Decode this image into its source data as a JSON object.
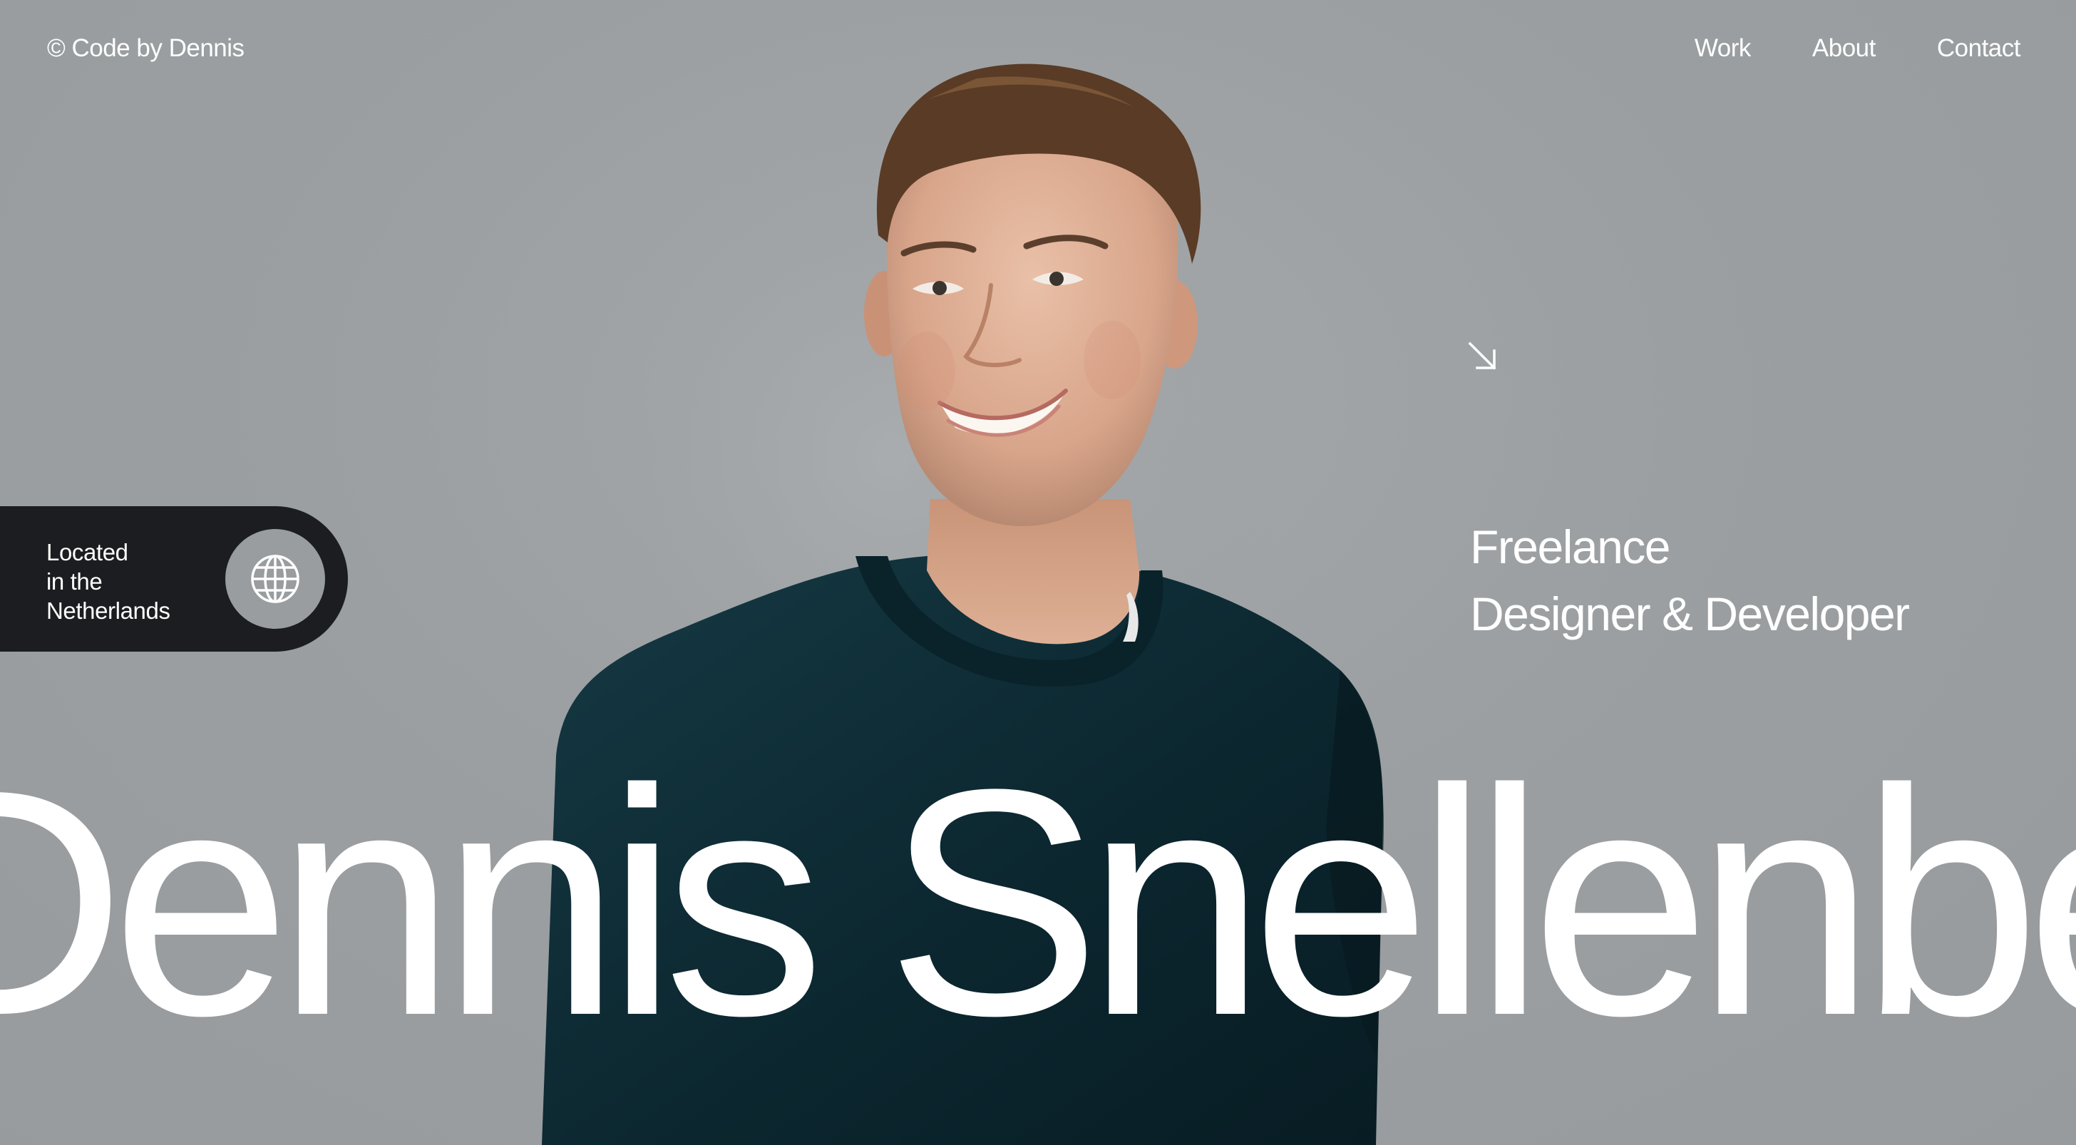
{
  "header": {
    "brand": "© Code by Dennis",
    "nav": [
      "Work",
      "About",
      "Contact"
    ]
  },
  "location": {
    "lines": [
      "Located",
      "in the",
      "Netherlands"
    ],
    "icon": "globe-icon"
  },
  "tagline": {
    "arrow_icon": "arrow-down-right-icon",
    "lines": [
      "Freelance",
      "Designer & Developer"
    ]
  },
  "hero": {
    "name": "Dennis Snellenberg"
  },
  "colors": {
    "background": "#999d9f",
    "pill": "#1c1d20",
    "sweater": "#0d2a33",
    "text": "#ffffff"
  }
}
